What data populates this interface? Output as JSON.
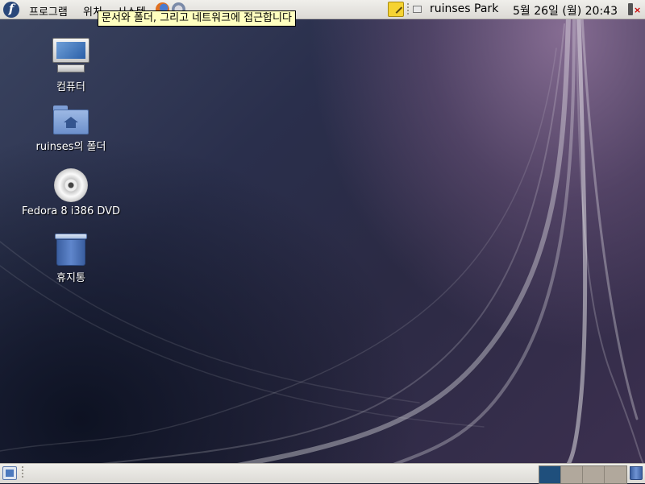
{
  "top_panel": {
    "menus": [
      {
        "label": "프로그램"
      },
      {
        "label": "위치"
      },
      {
        "label": "시스템"
      }
    ],
    "tooltip": "문서와 폴더, 그리고 네트워크에 접근합니다",
    "user": "ruinses Park",
    "clock": "5월 26일 (월) 20:43",
    "launchers": [
      "firefox-icon",
      "mail-icon"
    ],
    "notes_icon": "notes-icon"
  },
  "desktop_icons": [
    {
      "label": "컴퓨터",
      "icon": "computer-icon"
    },
    {
      "label": "ruinses의 폴더",
      "icon": "home-folder-icon"
    },
    {
      "label": "Fedora 8 i386 DVD",
      "icon": "dvd-icon"
    },
    {
      "label": "휴지통",
      "icon": "trash-icon"
    }
  ],
  "bottom_panel": {
    "workspaces": 4,
    "active_workspace": 1
  },
  "colors": {
    "panel": "#dcdad5",
    "tooltip_bg": "#ffffbf",
    "active_workspace": "#1f4f7c"
  }
}
